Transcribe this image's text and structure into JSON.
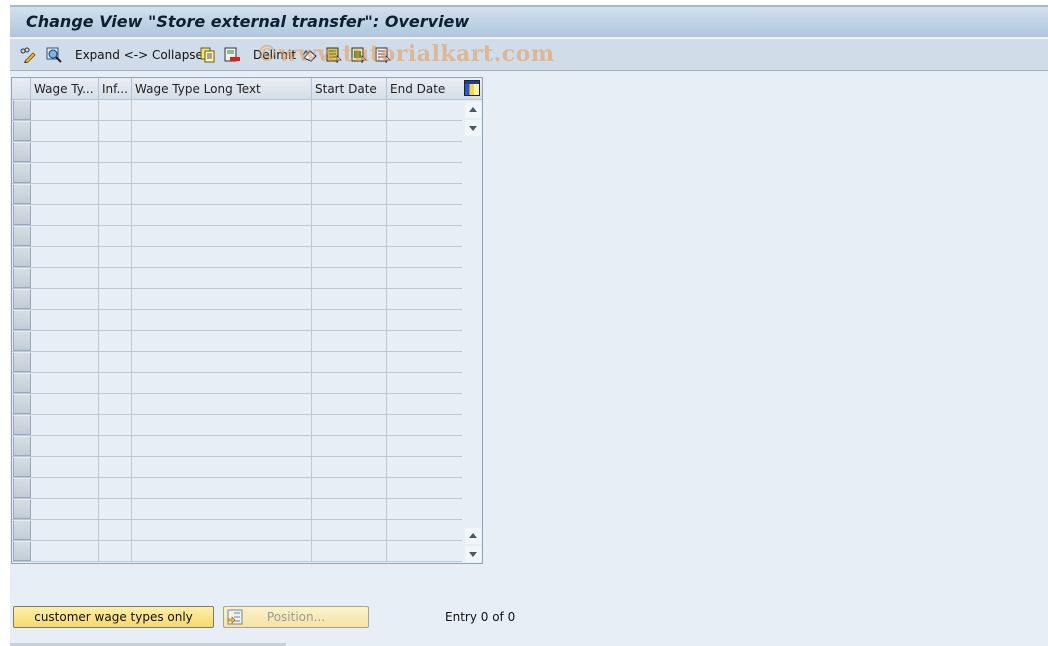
{
  "window": {
    "title": "Change View \"Store external transfer\": Overview"
  },
  "toolbar": {
    "items": [
      {
        "name": "display-change-icon",
        "label": ""
      },
      {
        "name": "find-icon",
        "label": ""
      },
      {
        "name": "expand-collapse",
        "label": "Expand <-> Collapse"
      },
      {
        "name": "copy-icon",
        "label": ""
      },
      {
        "name": "delete-icon",
        "label": ""
      },
      {
        "name": "delimit",
        "label": "Delimit"
      },
      {
        "name": "undo-change-icon",
        "label": ""
      },
      {
        "name": "select-all-icon",
        "label": ""
      },
      {
        "name": "select-block-icon",
        "label": ""
      },
      {
        "name": "deselect-all-icon",
        "label": ""
      }
    ],
    "watermark": "©www.tutorialkart.com"
  },
  "table": {
    "columns": [
      {
        "key": "wage_type",
        "label": "Wage Ty..."
      },
      {
        "key": "inf",
        "label": "Inf..."
      },
      {
        "key": "long_text",
        "label": "Wage Type Long Text"
      },
      {
        "key": "start_date",
        "label": "Start Date"
      },
      {
        "key": "end_date",
        "label": "End Date"
      }
    ],
    "rows": [
      {},
      {},
      {},
      {},
      {},
      {},
      {},
      {},
      {},
      {},
      {},
      {},
      {},
      {},
      {},
      {},
      {},
      {},
      {},
      {},
      {},
      {}
    ],
    "column_settings_icon": "table-settings-icon"
  },
  "footer": {
    "customer_button": "customer wage types only",
    "position_button": "Position...",
    "entry_text": "Entry 0 of 0"
  },
  "colors": {
    "background": "#e8eef6",
    "title_bar": "#b0c6de",
    "toolbar": "#d0dde8",
    "button_yellow": "#f7d96c"
  }
}
